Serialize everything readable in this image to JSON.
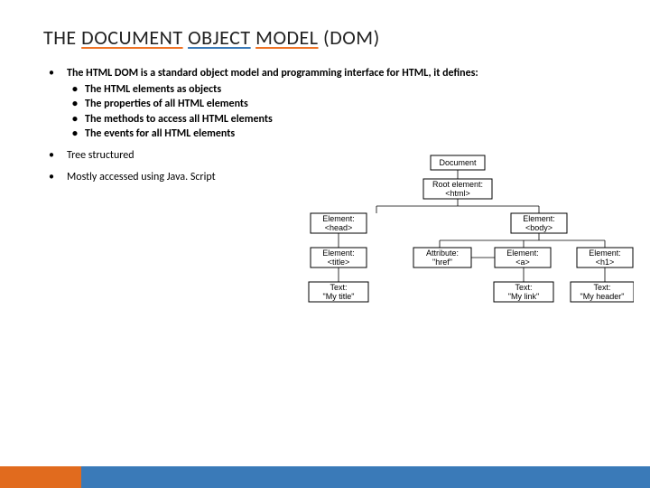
{
  "title": {
    "w1": "THE",
    "w2": "DOCUMENT",
    "w3": "OBJECT",
    "w4": "MODEL",
    "rest": "(DOM)"
  },
  "bullets": {
    "intro": "The HTML DOM is a standard object model and programming interface for HTML, it defines:",
    "sub": [
      "The HTML elements as objects",
      "The properties of all HTML elements",
      "The methods to access all HTML elements",
      "The events for all HTML elements"
    ],
    "b2": "Tree structured",
    "b3": "Mostly accessed using Java. Script"
  },
  "diagram": {
    "document": "Document",
    "root": {
      "l1": "Root element:",
      "l2": "<html>"
    },
    "head": {
      "l1": "Element:",
      "l2": "<head>"
    },
    "body": {
      "l1": "Element:",
      "l2": "<body>"
    },
    "title": {
      "l1": "Element:",
      "l2": "<title>"
    },
    "href": {
      "l1": "Attribute:",
      "l2": "\"href\""
    },
    "a": {
      "l1": "Element:",
      "l2": "<a>"
    },
    "h1": {
      "l1": "Element:",
      "l2": "<h1>"
    },
    "t_title": {
      "l1": "Text:",
      "l2": "\"My title\""
    },
    "t_link": {
      "l1": "Text:",
      "l2": "\"My link\""
    },
    "t_header": {
      "l1": "Text:",
      "l2": "\"My header\""
    }
  }
}
